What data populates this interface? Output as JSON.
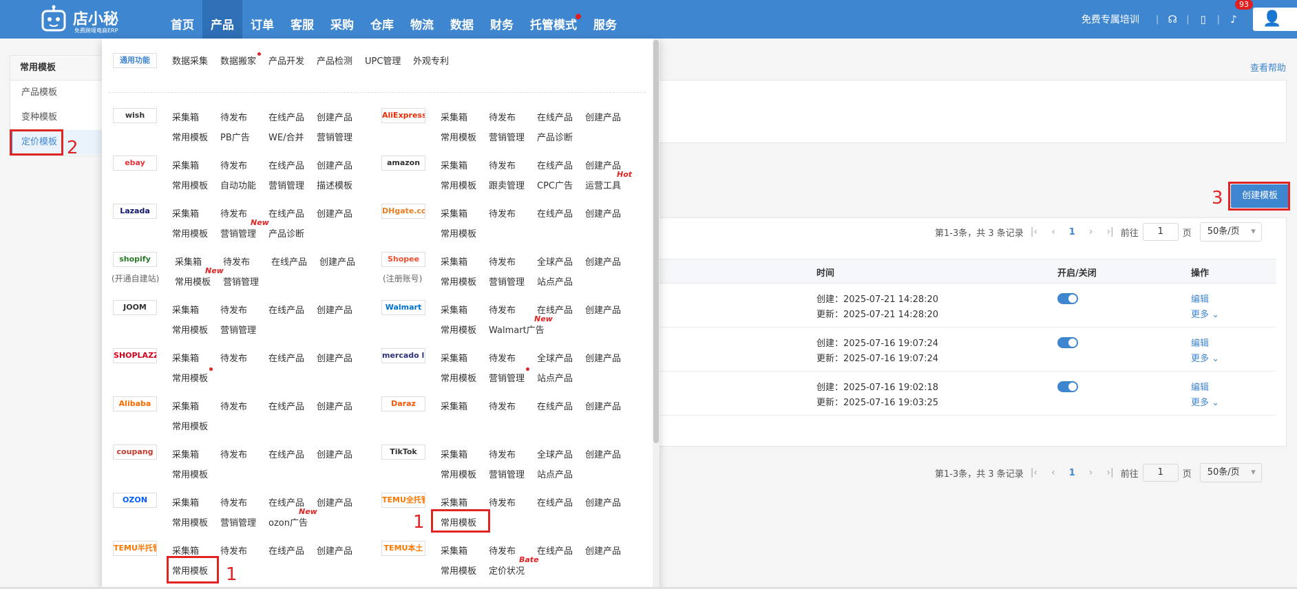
{
  "brand": {
    "name": "店小秘",
    "tagline": "免费跨境电商ERP"
  },
  "nav": [
    "首页",
    "产品",
    "订单",
    "客服",
    "采购",
    "仓库",
    "物流",
    "数据",
    "财务",
    "托管模式",
    "服务"
  ],
  "topright": {
    "training": "免费专属培训",
    "notifications": "93"
  },
  "sidebar": {
    "title": "常用模板",
    "items": [
      "产品模板",
      "变种模板",
      "定价模板"
    ]
  },
  "annotations": {
    "one": "1",
    "two": "2",
    "three": "3"
  },
  "help": "查看帮助",
  "create_button": "创建模板",
  "pagination": {
    "summary": "第1-3条，共 3 条记录",
    "page": "1",
    "goto": "前往",
    "goto_value": "1",
    "unit": "页",
    "size": "50条/页"
  },
  "table": {
    "headers": {
      "time": "时间",
      "toggle": "开启/关闭",
      "ops": "操作"
    },
    "rows": [
      {
        "created": "创建：2025-07-21 14:28:20",
        "updated": "更新：2025-07-21 14:28:20",
        "edit": "编辑",
        "more": "更多 ⌄"
      },
      {
        "created": "创建：2025-07-16 19:07:24",
        "updated": "更新：2025-07-16 19:07:24",
        "edit": "编辑",
        "more": "更多 ⌄"
      },
      {
        "created": "创建：2025-07-16 19:02:18",
        "updated": "更新：2025-07-16 19:03:25",
        "edit": "编辑",
        "more": "更多 ⌄"
      }
    ]
  },
  "dropdown": {
    "general": {
      "logo": "通用功能",
      "links": [
        "数据采集",
        "数据搬家",
        "产品开发",
        "产品检测",
        "UPC管理",
        "外观专利"
      ]
    },
    "common": {
      "collect": "采集箱",
      "pending": "待发布",
      "online": "在线产品",
      "create": "创建产品",
      "template": "常用模板",
      "marketing": "营销管理",
      "global": "全球产品",
      "site": "站点产品"
    },
    "wish": {
      "logo": "wish",
      "extra": [
        "PB广告",
        "WE/合并"
      ]
    },
    "aliexpress": {
      "logo": "AliExpress",
      "extra": [
        "产品诊断"
      ]
    },
    "ebay": {
      "logo": "ebay",
      "extra": [
        "自动功能",
        "描述模板"
      ]
    },
    "amazon": {
      "logo": "amazon",
      "extra": [
        "跟卖管理",
        "CPC广告",
        "运营工具"
      ],
      "tag": "Hot"
    },
    "lazada": {
      "logo": "Lazada",
      "extra": [
        "产品诊断"
      ],
      "tag": "New"
    },
    "dhgate": {
      "logo": "DHgate.com"
    },
    "shopify": {
      "logo": "shopify",
      "sub": "(开通自建站)",
      "tag": "New"
    },
    "shopee": {
      "logo": "Shopee",
      "sub": "(注册账号)"
    },
    "joom": {
      "logo": "JOOM"
    },
    "walmart": {
      "logo": "Walmart",
      "extra": [
        "Walmart广告"
      ],
      "tag": "New"
    },
    "shoplazza": {
      "logo": "SHOPLAZZA"
    },
    "mercado": {
      "logo": "mercado libre"
    },
    "alibaba": {
      "logo": "Alibaba"
    },
    "daraz": {
      "logo": "Daraz"
    },
    "coupang": {
      "logo": "coupang"
    },
    "tiktok": {
      "logo": "TikTok"
    },
    "ozon": {
      "logo": "OZON",
      "extra": [
        "ozon广告"
      ],
      "tag": "New"
    },
    "temu_full": {
      "logo": "TEMU全托管"
    },
    "temu_semi": {
      "logo": "TEMU半托管"
    },
    "temu_local": {
      "logo": "TEMU本土",
      "extra": [
        "定价状况"
      ],
      "tag": "Bate"
    }
  },
  "colors": {
    "primary": "#3f86d0",
    "annotation": "#e02424"
  }
}
